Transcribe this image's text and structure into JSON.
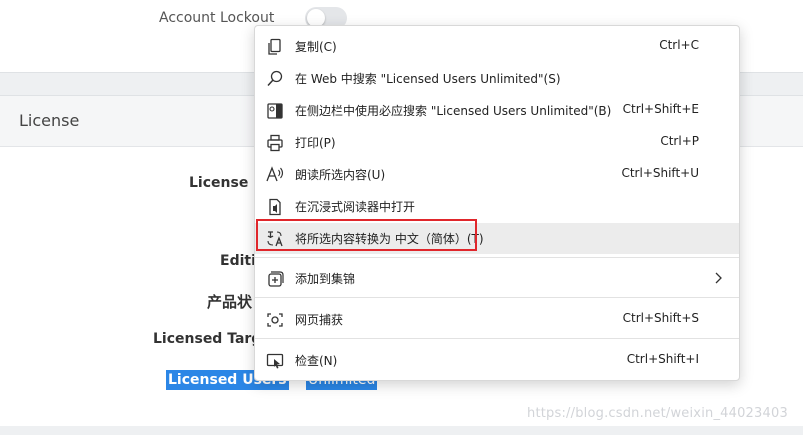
{
  "background": {
    "account_lockout_label": "Account Lockout",
    "license_header": "License",
    "fields": {
      "license_key": "License K",
      "edition": "Editi",
      "product_status": "产品状",
      "licensed_target": "Licensed Targe"
    },
    "selection": {
      "label": "Licensed Users",
      "value": "Unlimited"
    },
    "watermark": "https://blog.csdn.net/weixin_44023403"
  },
  "context_menu": {
    "items": [
      {
        "label": "复制(C)",
        "shortcut": "Ctrl+C",
        "icon": "copy-icon"
      },
      {
        "label": "在 Web 中搜索 \"Licensed Users Unlimited\"(S)",
        "shortcut": "",
        "icon": "search-icon"
      },
      {
        "label": "在侧边栏中使用必应搜索 \"Licensed Users Unlimited\"(B)",
        "shortcut": "Ctrl+Shift+E",
        "icon": "sidebar-search-icon"
      },
      {
        "label": "打印(P)",
        "shortcut": "Ctrl+P",
        "icon": "print-icon"
      },
      {
        "label": "朗读所选内容(U)",
        "shortcut": "Ctrl+Shift+U",
        "icon": "read-aloud-icon"
      },
      {
        "label": "在沉浸式阅读器中打开",
        "shortcut": "",
        "icon": "immersive-reader-icon"
      },
      {
        "label": "将所选内容转换为 中文（简体）(T)",
        "shortcut": "",
        "icon": "translate-icon"
      },
      {
        "label": "添加到集锦",
        "shortcut": "",
        "icon": "collections-icon"
      },
      {
        "label": "网页捕获",
        "shortcut": "Ctrl+Shift+S",
        "icon": "web-capture-icon"
      },
      {
        "label": "检查(N)",
        "shortcut": "Ctrl+Shift+I",
        "icon": "inspect-icon"
      }
    ]
  },
  "colors": {
    "selection": "#2b86e6",
    "highlight_box": "#e0262b",
    "menu_hover": "#ececec"
  }
}
